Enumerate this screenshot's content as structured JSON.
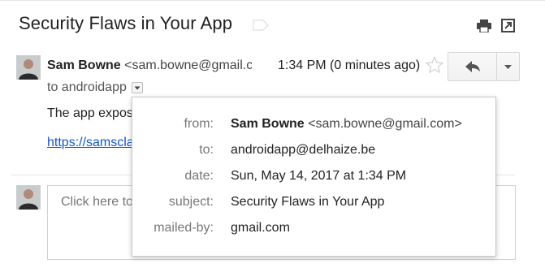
{
  "email": {
    "subject": "Security Flaws in Your App",
    "sender_name": "Sam Bowne",
    "sender_email_truncated": "<sam.bowne@gmail.c",
    "time": "1:34 PM (0 minutes ago)",
    "to_label": "to androidapp",
    "body_line": "The app expos",
    "link_text": "https://samscla"
  },
  "reply": {
    "placeholder": "Click here to"
  },
  "details": {
    "from_label": "from:",
    "from_name": "Sam Bowne",
    "from_email": "<sam.bowne@gmail.com>",
    "to_label": "to:",
    "to_value": "androidapp@delhaize.be",
    "date_label": "date:",
    "date_value": "Sun, May 14, 2017 at 1:34 PM",
    "subject_label": "subject:",
    "subject_value": "Security Flaws in Your App",
    "mailedby_label": "mailed-by:",
    "mailedby_value": "gmail.com"
  },
  "icons": {
    "print": "print-icon",
    "new_window": "open-in-new-window-icon",
    "star": "star-icon",
    "reply": "reply-arrow-icon",
    "more": "dropdown-arrow-icon",
    "label": "label-tag-icon",
    "details_toggle": "show-details-arrow-icon"
  },
  "colors": {
    "link": "#1155cc",
    "muted": "#777777",
    "border": "#c8c8c8"
  }
}
